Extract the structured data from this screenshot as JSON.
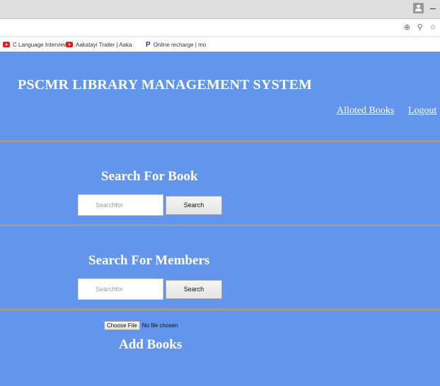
{
  "browser": {
    "minimize_glyph": "–",
    "address_icons": "⊕ ⚲ ☆",
    "bookmarks": [
      {
        "label": "C Language Interview",
        "icon": "youtube-icon"
      },
      {
        "label": "Aakatayi Trailer | Aaka",
        "icon": "youtube-icon"
      },
      {
        "label": "Online recharge | mo",
        "icon": "paytm-icon"
      }
    ]
  },
  "header": {
    "title": "PSCMR LIBRARY MANAGEMENT SYSTEM",
    "nav": {
      "alloted_books": "Alloted Books",
      "logout": "Logout"
    }
  },
  "search_book": {
    "heading": "Search For Book",
    "placeholder": "Searchfor",
    "button": "Search"
  },
  "search_members": {
    "heading": "Search For Members",
    "placeholder": "Searchfor",
    "button": "Search"
  },
  "add_books": {
    "heading": "Add Books",
    "file_button": "Choose File",
    "file_status": "No file chosen"
  },
  "colors": {
    "page_background": "#6495ed",
    "divider": "#9a9a9a"
  }
}
